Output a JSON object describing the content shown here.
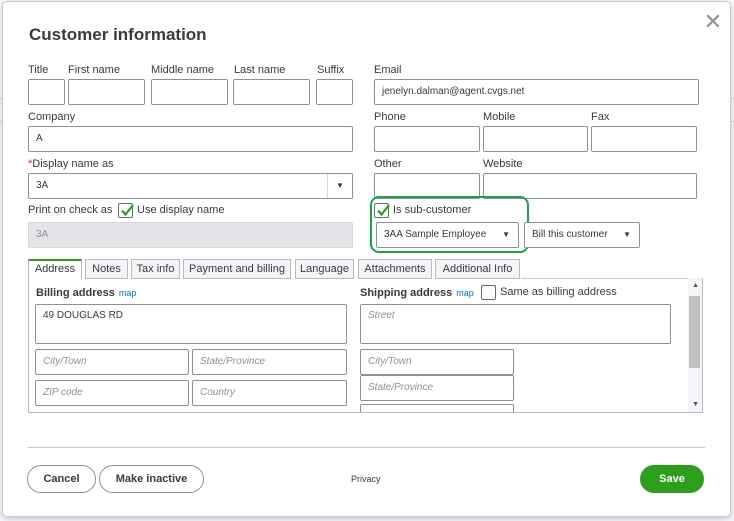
{
  "dialog": {
    "title": "Customer information",
    "close_glyph": "✕"
  },
  "name_fields": {
    "title_label": "Title",
    "first_label": "First name",
    "middle_label": "Middle name",
    "last_label": "Last name",
    "suffix_label": "Suffix",
    "title_value": "",
    "first_value": "",
    "middle_value": "",
    "last_value": "",
    "suffix_value": ""
  },
  "company": {
    "label": "Company",
    "value": "A"
  },
  "display_name": {
    "required_mark": "*",
    "label": "Display name as",
    "value": "3A"
  },
  "print_on_check": {
    "label": "Print on check as",
    "use_display_label": "Use display name",
    "use_display_checked": true,
    "value": "3A"
  },
  "contact": {
    "email_label": "Email",
    "email_value": "jenelyn.dalman@agent.cvgs.net",
    "phone_label": "Phone",
    "mobile_label": "Mobile",
    "fax_label": "Fax",
    "other_label": "Other",
    "website_label": "Website"
  },
  "sub_customer": {
    "label": "Is sub-customer",
    "checked": true,
    "parent_value": "3AA Sample Employee",
    "billing_option": "Bill this customer"
  },
  "tabs": [
    {
      "label": "Address",
      "active": true
    },
    {
      "label": "Notes"
    },
    {
      "label": "Tax info"
    },
    {
      "label": "Payment and billing"
    },
    {
      "label": "Language"
    },
    {
      "label": "Attachments"
    },
    {
      "label": "Additional Info"
    }
  ],
  "address": {
    "billing_label": "Billing address",
    "map_link": "map",
    "billing_street": "49 DOUGLAS RD",
    "city_placeholder": "City/Town",
    "state_placeholder": "State/Province",
    "zip_placeholder": "ZIP code",
    "country_placeholder": "Country",
    "shipping_label": "Shipping address",
    "same_as_billing_label": "Same as billing address",
    "same_as_billing_checked": false,
    "street_placeholder": "Street"
  },
  "footer": {
    "cancel_label": "Cancel",
    "make_inactive_label": "Make inactive",
    "privacy_label": "Privacy",
    "save_label": "Save"
  },
  "colors": {
    "accent": "#2ca01c",
    "highlight_box": "#1aa34a",
    "link": "#0077c5",
    "required": "#d52b1e"
  }
}
